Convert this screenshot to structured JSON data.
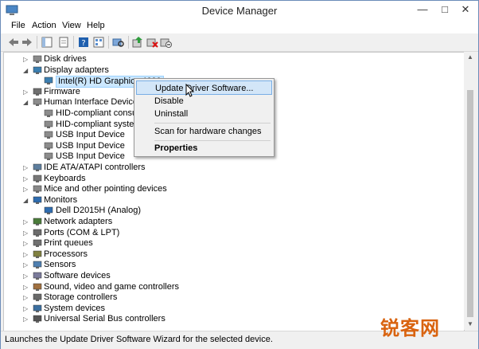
{
  "window": {
    "title": "Device Manager"
  },
  "menubar": {
    "items": [
      "File",
      "Action",
      "View",
      "Help"
    ]
  },
  "tree": [
    {
      "label": "Disk drives",
      "level": 1,
      "expanded": false,
      "icon": "disk-icon"
    },
    {
      "label": "Display adapters",
      "level": 1,
      "expanded": true,
      "icon": "display-icon"
    },
    {
      "label": "Intel(R) HD Graphics 4600",
      "level": 2,
      "selected": true,
      "icon": "display-icon"
    },
    {
      "label": "Firmware",
      "level": 1,
      "expanded": false,
      "icon": "firmware-icon"
    },
    {
      "label": "Human Interface Devices",
      "level": 1,
      "expanded": true,
      "icon": "hid-icon"
    },
    {
      "label": "HID-compliant consumer control device",
      "level": 2,
      "icon": "hid-icon"
    },
    {
      "label": "HID-compliant system controller",
      "level": 2,
      "icon": "hid-icon"
    },
    {
      "label": "USB Input Device",
      "level": 2,
      "icon": "hid-icon"
    },
    {
      "label": "USB Input Device",
      "level": 2,
      "icon": "hid-icon"
    },
    {
      "label": "USB Input Device",
      "level": 2,
      "icon": "hid-icon"
    },
    {
      "label": "IDE ATA/ATAPI controllers",
      "level": 1,
      "expanded": false,
      "icon": "ide-icon"
    },
    {
      "label": "Keyboards",
      "level": 1,
      "expanded": false,
      "icon": "keyboard-icon"
    },
    {
      "label": "Mice and other pointing devices",
      "level": 1,
      "expanded": false,
      "icon": "mouse-icon"
    },
    {
      "label": "Monitors",
      "level": 1,
      "expanded": true,
      "icon": "monitor-icon"
    },
    {
      "label": "Dell D2015H (Analog)",
      "level": 2,
      "icon": "monitor-icon"
    },
    {
      "label": "Network adapters",
      "level": 1,
      "expanded": false,
      "icon": "network-icon"
    },
    {
      "label": "Ports (COM & LPT)",
      "level": 1,
      "expanded": false,
      "icon": "port-icon"
    },
    {
      "label": "Print queues",
      "level": 1,
      "expanded": false,
      "icon": "printer-icon"
    },
    {
      "label": "Processors",
      "level": 1,
      "expanded": false,
      "icon": "processor-icon"
    },
    {
      "label": "Sensors",
      "level": 1,
      "expanded": false,
      "icon": "sensor-icon"
    },
    {
      "label": "Software devices",
      "level": 1,
      "expanded": false,
      "icon": "software-icon"
    },
    {
      "label": "Sound, video and game controllers",
      "level": 1,
      "expanded": false,
      "icon": "sound-icon"
    },
    {
      "label": "Storage controllers",
      "level": 1,
      "expanded": false,
      "icon": "storage-icon"
    },
    {
      "label": "System devices",
      "level": 1,
      "expanded": false,
      "icon": "system-icon"
    },
    {
      "label": "Universal Serial Bus controllers",
      "level": 1,
      "expanded": false,
      "icon": "usb-icon"
    }
  ],
  "context_menu": {
    "update": "Update Driver Software...",
    "disable": "Disable",
    "uninstall": "Uninstall",
    "scan": "Scan for hardware changes",
    "properties": "Properties"
  },
  "status": {
    "text": "Launches the Update Driver Software Wizard for the selected device."
  },
  "watermark": {
    "text": "锐客网"
  },
  "colors": {
    "accent": "#3c7fb1",
    "selection": "#cce8ff",
    "watermark": "#d9630f"
  }
}
